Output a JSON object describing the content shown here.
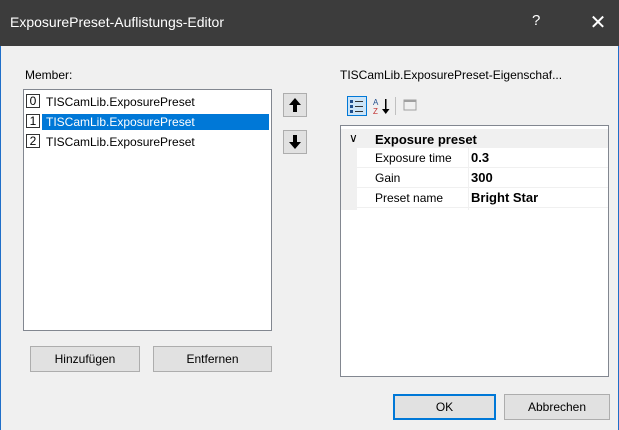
{
  "window": {
    "title": "ExposurePreset-Auflistungs-Editor",
    "help_glyph": "?",
    "close_glyph": "✕"
  },
  "members": {
    "label": "Member:",
    "items": [
      {
        "index": "0",
        "text": "TISCamLib.ExposurePreset"
      },
      {
        "index": "1",
        "text": "TISCamLib.ExposurePreset"
      },
      {
        "index": "2",
        "text": "TISCamLib.ExposurePreset"
      }
    ],
    "selected_index": 1,
    "move_up_glyph": "🡡",
    "move_down_glyph": "🡣",
    "add_label": "Hinzufügen",
    "remove_label": "Entfernen"
  },
  "properties": {
    "header": "TISCamLib.ExposurePreset-Eigenschaf...",
    "category": "Exposure preset",
    "category_glyph": "∨",
    "rows": [
      {
        "name": "Exposure time",
        "value": "0.3"
      },
      {
        "name": "Gain",
        "value": "300"
      },
      {
        "name": "Preset name",
        "value": "Bright Star"
      }
    ]
  },
  "footer": {
    "ok_label": "OK",
    "cancel_label": "Abbrechen"
  },
  "colors": {
    "selection": "#0078d7",
    "titlebar": "#3c3c3c",
    "frame": "#1f6fc9"
  }
}
